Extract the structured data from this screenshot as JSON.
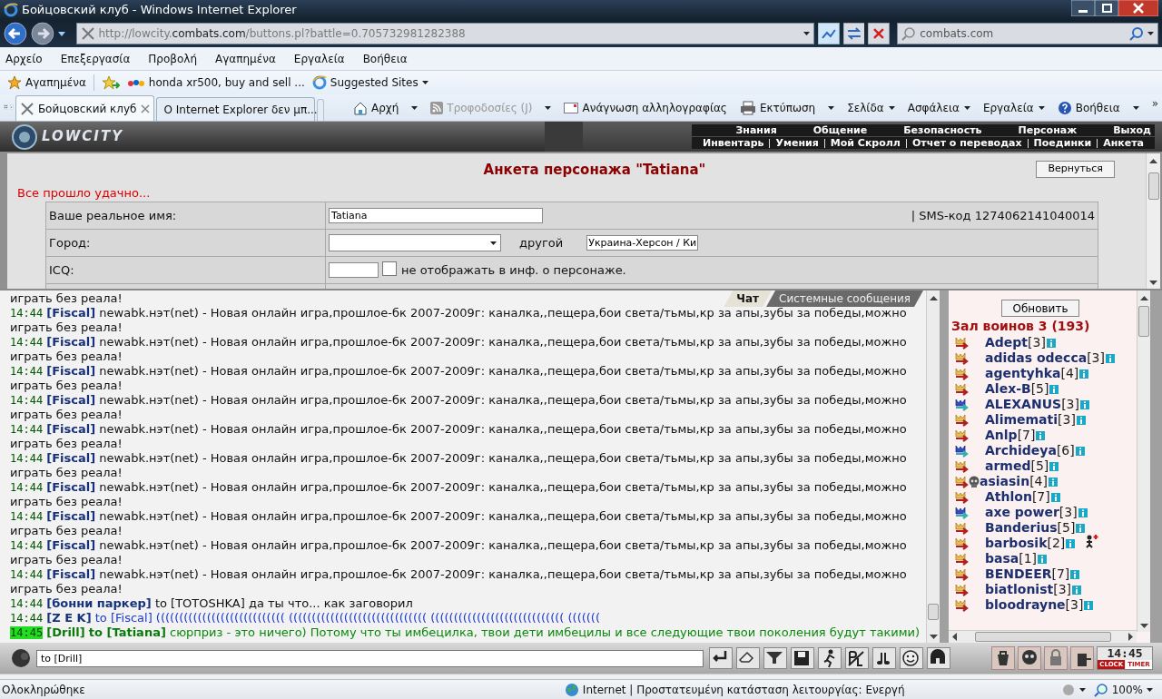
{
  "window": {
    "title": "Бойцовский клуб - Windows Internet Explorer"
  },
  "address": {
    "prefix": "http://lowcity.",
    "domain": "combats.com",
    "suffix": "/buttons.pl?battle=0.705732981282388"
  },
  "search": {
    "value": "combats.com"
  },
  "menu": [
    "Αρχείο",
    "Επεξεργασία",
    "Προβολή",
    "Αγαπημένα",
    "Εργαλεία",
    "Βοήθεια"
  ],
  "favorites": [
    {
      "label": "Αγαπημένα",
      "kind": "star"
    },
    {
      "label": "honda xr500, buy and sell ...",
      "kind": "ebay"
    },
    {
      "label": "Suggested Sites",
      "kind": "ie"
    }
  ],
  "tabs": [
    {
      "label": "Бойцовский клуб",
      "selected": true,
      "kind": "swords"
    },
    {
      "label": "O Internet Explorer δεν μπ...",
      "selected": false,
      "kind": "ie"
    }
  ],
  "commands": [
    {
      "label": "Αρχή",
      "kind": "home",
      "disabled": false,
      "dropdown": true
    },
    {
      "label": "Τροφοδοσίες (J)",
      "kind": "feed",
      "disabled": true,
      "dropdown": true
    },
    {
      "label": "Ανάγνωση αλληλογραφίας",
      "kind": "mail",
      "disabled": false,
      "dropdown": false
    },
    {
      "label": "Εκτύπωση",
      "kind": "print",
      "disabled": false,
      "dropdown": true
    },
    {
      "label": "Σελίδα",
      "kind": "none",
      "disabled": false,
      "dropdown": true
    },
    {
      "label": "Ασφάλεια",
      "kind": "none",
      "disabled": false,
      "dropdown": true
    },
    {
      "label": "Εργαλεία",
      "kind": "none",
      "disabled": false,
      "dropdown": true
    },
    {
      "label": "Βοήθεια",
      "kind": "help",
      "disabled": false,
      "dropdown": true
    }
  ],
  "more_commands": "»",
  "game": {
    "logo": "LOWCITY",
    "nav_top": [
      "Знания",
      "Общение",
      "Безопасность",
      "Персонаж",
      "Выход"
    ],
    "nav_bottom": [
      "Инвентарь",
      "Умения",
      "Мой Скролл",
      "Отчет о переводах",
      "Поединки",
      "Анкета"
    ]
  },
  "profile": {
    "title": "Анкета персонажа \"Tatiana\"",
    "back_button": "Вернуться",
    "notice": "Все прошло удачно...",
    "name_label": "Ваше реальное имя:",
    "name_value": "Tatiana",
    "sms": "| SMS-код 1274062141040014",
    "city_label": "Город:",
    "other_label": "другой",
    "other_value": "Украина-Херсон / Ки",
    "icq_label": "ICQ:",
    "icq_hide_checked": false,
    "icq_hide_label": "не отображать в инф. о персонаже."
  },
  "chat": {
    "tabs": [
      {
        "label": "Чат",
        "selected": true
      },
      {
        "label": "Системные сообщения",
        "selected": false
      }
    ],
    "top_line": "играть без реала!",
    "messages": [
      {
        "time": "14:44",
        "sender": "[Fiscal]",
        "text": "newabk.нэт(net) - Новая онлайн игра,прошлое-бк 2007-2009г: каналка,,пещера,бои света/тьмы,кр за апы,зубы за победы,можно играть без реала!",
        "kind": "public",
        "highlighted": false
      },
      {
        "time": "14:44",
        "sender": "[Fiscal]",
        "text": "newabk.нэт(net) - Новая онлайн игра,прошлое-бк 2007-2009г: каналка,,пещера,бои света/тьмы,кр за апы,зубы за победы,можно играть без реала!",
        "kind": "public",
        "highlighted": false
      },
      {
        "time": "14:44",
        "sender": "[Fiscal]",
        "text": "newabk.нэт(net) - Новая онлайн игра,прошлое-бк 2007-2009г: каналка,,пещера,бои света/тьмы,кр за апы,зубы за победы,можно играть без реала!",
        "kind": "public",
        "highlighted": false
      },
      {
        "time": "14:44",
        "sender": "[Fiscal]",
        "text": "newabk.нэт(net) - Новая онлайн игра,прошлое-бк 2007-2009г: каналка,,пещера,бои света/тьмы,кр за апы,зубы за победы,можно играть без реала!",
        "kind": "public",
        "highlighted": false
      },
      {
        "time": "14:44",
        "sender": "[Fiscal]",
        "text": "newabk.нэт(net) - Новая онлайн игра,прошлое-бк 2007-2009г: каналка,,пещера,бои света/тьмы,кр за апы,зубы за победы,можно играть без реала!",
        "kind": "public",
        "highlighted": false
      },
      {
        "time": "14:44",
        "sender": "[Fiscal]",
        "text": "newabk.нэт(net) - Новая онлайн игра,прошлое-бк 2007-2009г: каналка,,пещера,бои света/тьмы,кр за апы,зубы за победы,можно играть без реала!",
        "kind": "public",
        "highlighted": false
      },
      {
        "time": "14:44",
        "sender": "[Fiscal]",
        "text": "newabk.нэт(net) - Новая онлайн игра,прошлое-бк 2007-2009г: каналка,,пещера,бои света/тьмы,кр за апы,зубы за победы,можно играть без реала!",
        "kind": "public",
        "highlighted": false
      },
      {
        "time": "14:44",
        "sender": "[Fiscal]",
        "text": "newabk.нэт(net) - Новая онлайн игра,прошлое-бк 2007-2009г: каналка,,пещера,бои света/тьмы,кр за апы,зубы за победы,можно играть без реала!",
        "kind": "public",
        "highlighted": false
      },
      {
        "time": "14:44",
        "sender": "[Fiscal]",
        "text": "newabk.нэт(net) - Новая онлайн игра,прошлое-бк 2007-2009г: каналка,,пещера,бои света/тьмы,кр за апы,зубы за победы,можно играть без реала!",
        "kind": "public",
        "highlighted": false
      },
      {
        "time": "14:44",
        "sender": "[Fiscal]",
        "text": "newabk.нэт(net) - Новая онлайн игра,прошлое-бк 2007-2009г: каналка,,пещера,бои света/тьмы,кр за апы,зубы за победы,можно играть без реала!",
        "kind": "public",
        "highlighted": false
      },
      {
        "time": "14:44",
        "sender": "[бонни паркер]",
        "recipient": "to [TOTOSHKA]",
        "text": "да ты что... как заговорил",
        "kind": "public",
        "highlighted": false
      },
      {
        "time": "14:44",
        "sender": "[Z E K]",
        "recipient": "to [Fiscal]",
        "text": "(((((((((((((((((((((((((((( (((((((((((((((((((((((((((((( ((((((((((((((((((((((((((((( (((((((",
        "kind": "to",
        "highlighted": false
      },
      {
        "time": "14:45",
        "sender": "[Drill]",
        "recipient": "to [Tatiana]",
        "text": "сюрприз - это ничего) Потому что ты имбецилка, твои дети имбецилы и все следующие твои поколения будут такими)",
        "kind": "private",
        "highlighted": true
      }
    ],
    "input": {
      "value": "to [Drill]"
    }
  },
  "players": {
    "refresh_button": "Обновить",
    "room": "Зал воинов 3 (193)",
    "list": [
      {
        "name": "Adept",
        "level": "[3]",
        "kind": "red",
        "skull": false,
        "injured": false
      },
      {
        "name": "adidas odecca",
        "level": "[3]",
        "kind": "red",
        "skull": false,
        "injured": false
      },
      {
        "name": "agentyhka",
        "level": "[4]",
        "kind": "red",
        "skull": false,
        "injured": false
      },
      {
        "name": "Alex-B",
        "level": "[5]",
        "kind": "red",
        "skull": false,
        "injured": false
      },
      {
        "name": "ALEXANUS",
        "level": "[3]",
        "kind": "blue",
        "skull": false,
        "injured": false
      },
      {
        "name": "Alimemati",
        "level": "[3]",
        "kind": "red",
        "skull": false,
        "injured": false
      },
      {
        "name": "Anlp",
        "level": "[7]",
        "kind": "red",
        "skull": false,
        "injured": false
      },
      {
        "name": "Archideya",
        "level": "[6]",
        "kind": "blue",
        "skull": false,
        "injured": false
      },
      {
        "name": "armed",
        "level": "[5]",
        "kind": "red",
        "skull": false,
        "injured": false
      },
      {
        "name": "asiasin",
        "level": "[4]",
        "kind": "red",
        "skull": true,
        "injured": false
      },
      {
        "name": "Athlon",
        "level": "[7]",
        "kind": "red",
        "skull": false,
        "injured": false
      },
      {
        "name": "axe power",
        "level": "[3]",
        "kind": "blue",
        "skull": false,
        "injured": false
      },
      {
        "name": "Banderius",
        "level": "[5]",
        "kind": "red",
        "skull": false,
        "injured": false
      },
      {
        "name": "barbosik",
        "level": "[2]",
        "kind": "red",
        "skull": false,
        "injured": true
      },
      {
        "name": "basa",
        "level": "[1]",
        "kind": "red",
        "skull": false,
        "injured": false
      },
      {
        "name": "BENDEER",
        "level": "[7]",
        "kind": "red",
        "skull": false,
        "injured": false
      },
      {
        "name": "biatlonist",
        "level": "[3]",
        "kind": "red",
        "skull": false,
        "injured": false
      },
      {
        "name": "bloodrayne",
        "level": "[3]",
        "kind": "red",
        "skull": false,
        "injured": false
      }
    ]
  },
  "clock": {
    "time": "14:45",
    "clock_label": "CLOCK",
    "timer_label": "TIMER"
  },
  "status_bar": {
    "text": "Ολοκληρώθηκε",
    "zone": "Internet | Προστατευμένη κατάσταση λειτουργίας: Ενεργή",
    "zoom": "100%"
  }
}
